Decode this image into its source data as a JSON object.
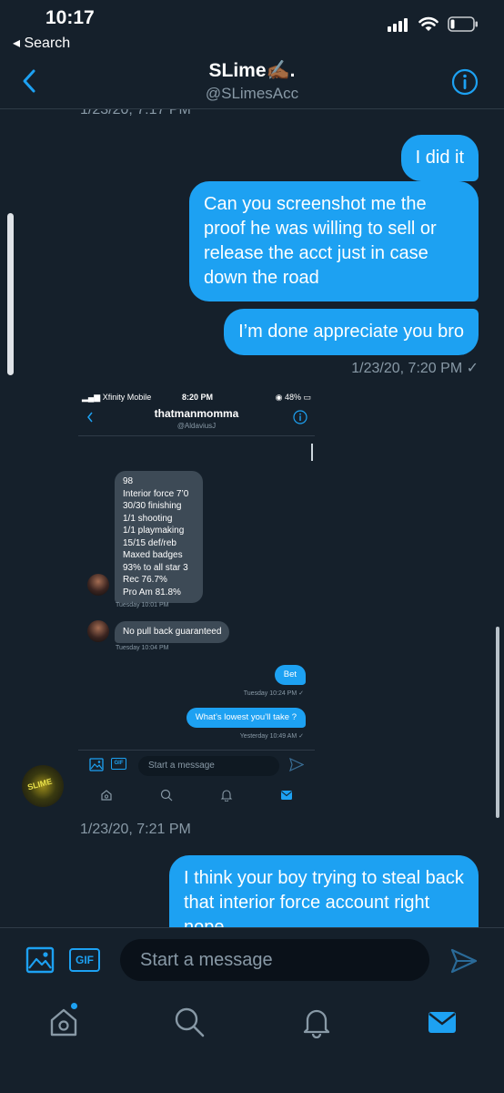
{
  "status_bar": {
    "time": "10:17",
    "back_label": "◂ Search"
  },
  "header": {
    "name": "SLime✍🏾.",
    "handle": "@SLimesAcc"
  },
  "conversation": {
    "top_timestamp": "1/23/20, 7:17 PM",
    "messages_sent": [
      "I did it",
      "Can you screenshot me the proof he was willing to sell or release the acct just in case down the road",
      "I’m done appreciate you bro"
    ],
    "sent_timestamp": "1/23/20, 7:20 PM ✓",
    "received_timestamp": "1/23/20, 7:21 PM",
    "last_message": "I think your boy trying to steal back that interior force account right nope"
  },
  "attached_screenshot": {
    "carrier": "Xfinity Mobile",
    "time": "8:20 PM",
    "battery": "48%",
    "contact_name": "thatmanmomma",
    "contact_handle": "@AldaviusJ",
    "stats_lines": [
      "98",
      "Interior force 7’0",
      "30/30 finishing",
      "1/1 shooting",
      "1/1 playmaking",
      "15/15 def/reb",
      "Maxed badges",
      "93% to all star 3",
      "Rec 76.7%",
      "Pro Am 81.8%"
    ],
    "ts_a": "Tuesday 10:01 PM",
    "msg_b": "No pull back guaranteed",
    "ts_b": "Tuesday 10:04 PM",
    "msg_c": "Bet",
    "ts_c": "Tuesday 10:24 PM ✓",
    "msg_d": "What’s lowest you’ll take ?",
    "ts_d": "Yesterday 10:49 AM ✓",
    "compose_placeholder": "Start a message",
    "gif_label": "GIF"
  },
  "avatar_text": "SLIME",
  "compose": {
    "gif_label": "GIF",
    "placeholder": "Start a message"
  },
  "colors": {
    "background": "#15202b",
    "accent": "#1da1f2",
    "muted": "#8899a6"
  }
}
